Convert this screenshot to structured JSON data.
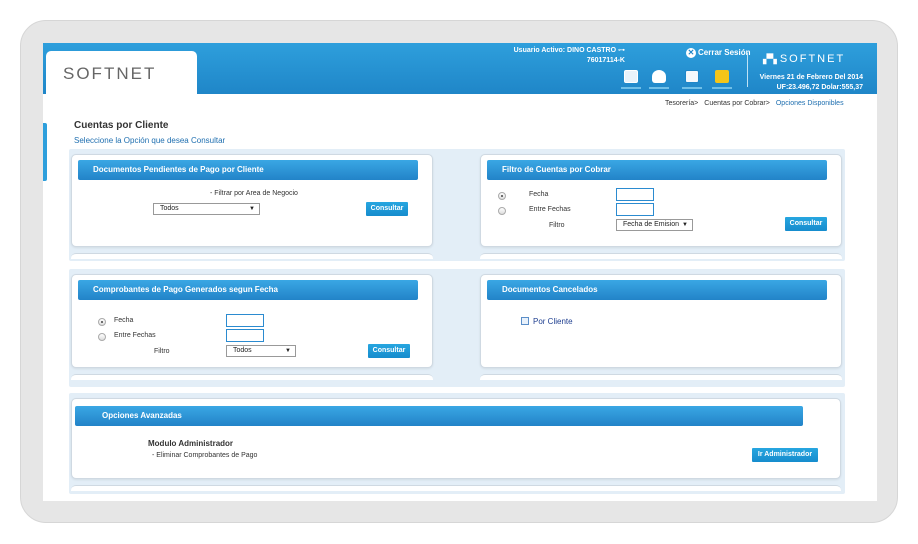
{
  "header": {
    "logo_text": "SOFTNET",
    "user_line1": "Usuario Activo: DINO CASTRO",
    "user_line2": "76017114-K",
    "close_session": "Cerrar Sesión",
    "brand_right": "SOFTNET",
    "date_line": "Viernes 21 de Febrero Del 2014",
    "rates_line": "UF:23.496,72 Dolar:555,37",
    "toolbar_icons": [
      "contacts-icon",
      "users-icon",
      "list-icon",
      "folder-icon"
    ],
    "colors": {
      "header_blue": "#2e9fdc",
      "button_blue": "#168ccd"
    }
  },
  "breadcrumb": {
    "items": [
      "Tesorería>",
      "Cuentas por Cobrar>",
      "Opciones Disponibles"
    ]
  },
  "page": {
    "title": "Cuentas por Cliente",
    "subtitle": "Seleccione la Opción que desea Consultar"
  },
  "panel_docs_pendientes": {
    "title": "Documentos Pendientes de Pago por Cliente",
    "filter_label": "- Filtrar por Area de Negocio",
    "select_value": "Todos",
    "button": "Consultar"
  },
  "panel_filtro_cuentas": {
    "title": "Filtro de Cuentas por Cobrar",
    "radio_fecha": "Fecha",
    "radio_entre": "Entre Fechas",
    "filtro_label": "Filtro",
    "select_value": "Fecha de Emision",
    "button": "Consultar"
  },
  "panel_comprobantes": {
    "title": "Comprobantes de Pago Generados segun Fecha",
    "radio_fecha": "Fecha",
    "radio_entre": "Entre Fechas",
    "filtro_label": "Filtro",
    "select_value": "Todos",
    "button": "Consultar"
  },
  "panel_cancelados": {
    "title": "Documentos Cancelados",
    "link": "Por Cliente"
  },
  "panel_avanzadas": {
    "title": "Opciones Avanzadas",
    "module_title": "Modulo Administrador",
    "module_desc": "- Eliminar Comprobantes de Pago",
    "button": "Ir Administrador"
  }
}
